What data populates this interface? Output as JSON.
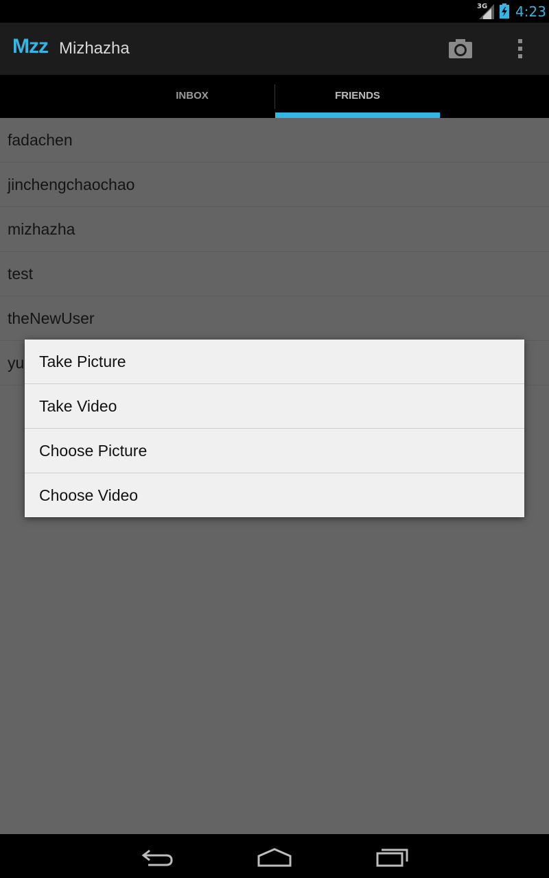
{
  "status_bar": {
    "network": "3G",
    "time": "4:23"
  },
  "action_bar": {
    "logo": "Mzz",
    "title": "Mizhazha"
  },
  "tabs": [
    {
      "label": "INBOX",
      "active": false
    },
    {
      "label": "FRIENDS",
      "active": true
    }
  ],
  "friends": [
    {
      "name": "fadachen"
    },
    {
      "name": "jinchengchaochao"
    },
    {
      "name": "mizhazha"
    },
    {
      "name": "test"
    },
    {
      "name": "theNewUser"
    },
    {
      "name": "yu"
    }
  ],
  "dialog": {
    "items": [
      {
        "label": "Take Picture"
      },
      {
        "label": "Take Video"
      },
      {
        "label": "Choose Picture"
      },
      {
        "label": "Choose Video"
      }
    ]
  },
  "icons": {
    "camera": "camera-icon",
    "overflow": "overflow-menu-icon",
    "back": "back-icon",
    "home": "home-icon",
    "recents": "recent-apps-icon"
  },
  "colors": {
    "accent": "#33b5e5",
    "dim_overlay": "#646464",
    "dialog_bg": "#f0f0f0"
  }
}
